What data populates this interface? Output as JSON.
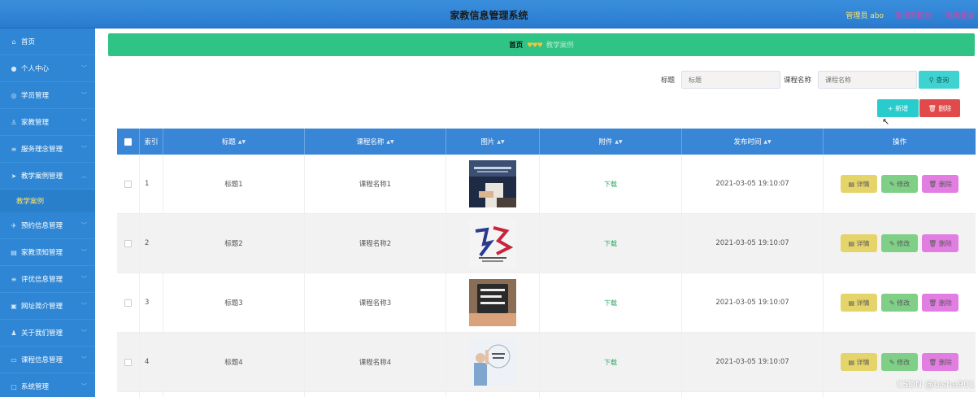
{
  "header": {
    "title": "家教信息管理系统",
    "admin": "管理员 abo",
    "back_to_front": "退出到前台",
    "logout": "退出登录"
  },
  "sidebar": {
    "items": [
      {
        "label": "首页",
        "icon": "home-icon"
      },
      {
        "label": "个人中心",
        "icon": "user-icon"
      },
      {
        "label": "学员管理",
        "icon": "student-icon"
      },
      {
        "label": "家教管理",
        "icon": "tutor-icon"
      },
      {
        "label": "服务理念管理",
        "icon": "list-icon"
      },
      {
        "label": "教学案例管理",
        "icon": "send-icon"
      },
      {
        "label": "预约信息管理",
        "icon": "plane-icon"
      },
      {
        "label": "家教须知管理",
        "icon": "notice-icon"
      },
      {
        "label": "评优信息管理",
        "icon": "list-icon"
      },
      {
        "label": "网址简介管理",
        "icon": "intro-icon"
      },
      {
        "label": "关于我们管理",
        "icon": "about-icon"
      },
      {
        "label": "课程信息管理",
        "icon": "course-icon"
      },
      {
        "label": "系统管理",
        "icon": "system-icon"
      }
    ],
    "subitem": "教学案例"
  },
  "breadcrumb": {
    "home": "首页",
    "hearts": "♥♥♥",
    "current": "教学案例"
  },
  "search": {
    "title_label": "标题",
    "title_placeholder": "标题",
    "course_label": "课程名称",
    "course_placeholder": "课程名称",
    "query": "查询"
  },
  "actions": {
    "add": "新增",
    "delete": "删除"
  },
  "table": {
    "headers": {
      "index": "索引",
      "title": "标题",
      "course": "课程名称",
      "image": "图片",
      "attachment": "附件",
      "time": "发布时间",
      "ops": "操作"
    },
    "rows": [
      {
        "index": "1",
        "title": "标题1",
        "course": "课程名称1",
        "attachment": "下载",
        "time": "2021-03-05 19:10:07"
      },
      {
        "index": "2",
        "title": "标题2",
        "course": "课程名称2",
        "attachment": "下载",
        "time": "2021-03-05 19:10:07"
      },
      {
        "index": "3",
        "title": "标题3",
        "course": "课程名称3",
        "attachment": "下载",
        "time": "2021-03-05 19:10:07"
      },
      {
        "index": "4",
        "title": "标题4",
        "course": "课程名称4",
        "attachment": "下载",
        "time": "2021-03-05 19:10:07"
      }
    ],
    "op_labels": {
      "detail": "详情",
      "edit": "修改",
      "remove": "删除"
    }
  },
  "watermark": "CSDN @bishe901"
}
